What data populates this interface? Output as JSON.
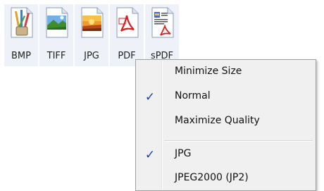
{
  "formats": [
    {
      "label": "BMP",
      "icon": "bmp-file-icon"
    },
    {
      "label": "TIFF",
      "icon": "tiff-file-icon"
    },
    {
      "label": "JPG",
      "icon": "jpg-file-icon"
    },
    {
      "label": "PDF",
      "icon": "pdf-file-icon"
    },
    {
      "label": "sPDF",
      "icon": "spdf-file-icon"
    }
  ],
  "menu": {
    "items": [
      {
        "label": "Minimize Size",
        "checked": false
      },
      {
        "label": "Normal",
        "checked": true
      },
      {
        "label": "Maximize Quality",
        "checked": false
      },
      {
        "label": "JPG",
        "checked": true
      },
      {
        "label": "JPEG2000 (JP2)",
        "checked": false
      }
    ],
    "check_glyph": "✓"
  },
  "colors": {
    "tile_background": "#eef1f8",
    "menu_background": "#f0f0f0",
    "check_color": "#1c3fa8"
  }
}
